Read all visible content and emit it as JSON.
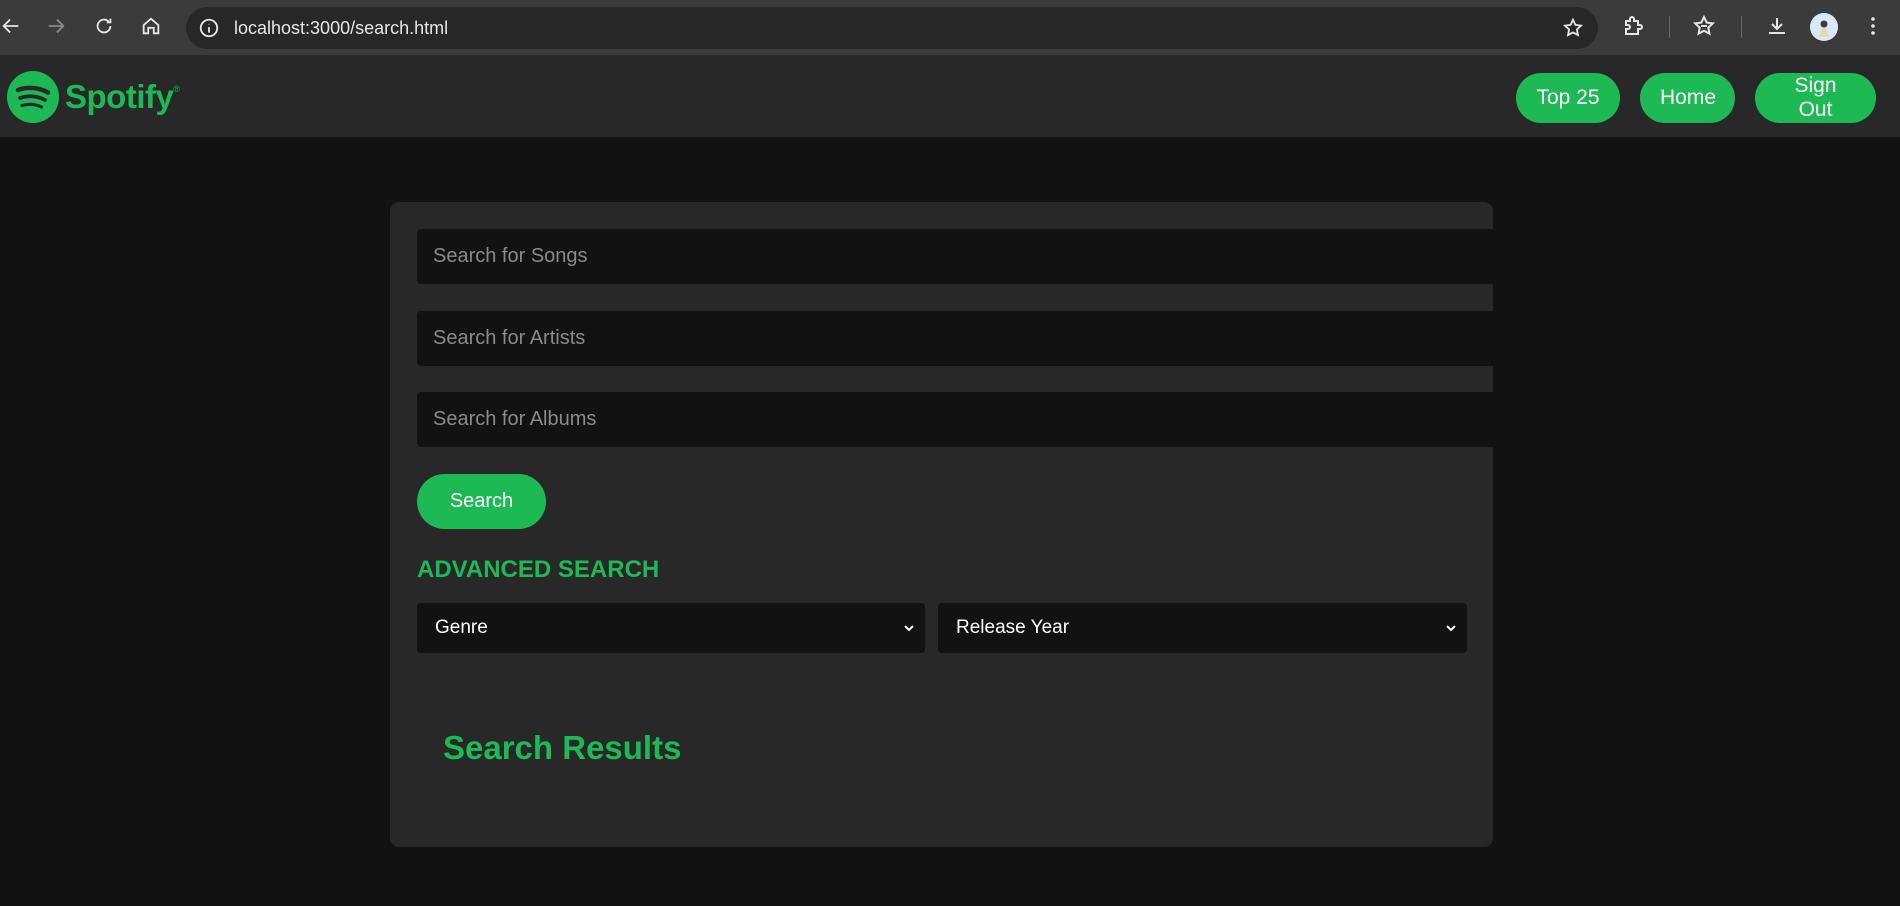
{
  "browser": {
    "url": "localhost:3000/search.html"
  },
  "header": {
    "brand": "Spotify",
    "brand_mark": "®",
    "buttons": {
      "top25": "Top 25",
      "home": "Home",
      "signout": "Sign Out"
    }
  },
  "search": {
    "songs_placeholder": "Search for Songs",
    "artists_placeholder": "Search for Artists",
    "albums_placeholder": "Search for Albums",
    "button_label": "Search"
  },
  "advanced": {
    "title": "ADVANCED SEARCH",
    "genre_selected": "Genre",
    "year_selected": "Release Year"
  },
  "results": {
    "title": "Search Results"
  },
  "colors": {
    "accent": "#1db954",
    "background": "#121212",
    "surface": "#282828"
  },
  "icons": [
    "back-icon",
    "forward-icon",
    "reload-icon",
    "home-icon",
    "info-icon",
    "bookmark-star-icon",
    "extensions-icon",
    "bookmarks-icon",
    "download-icon",
    "profile-avatar",
    "menu-icon",
    "spotify-logo-icon",
    "chevron-down-icon"
  ]
}
